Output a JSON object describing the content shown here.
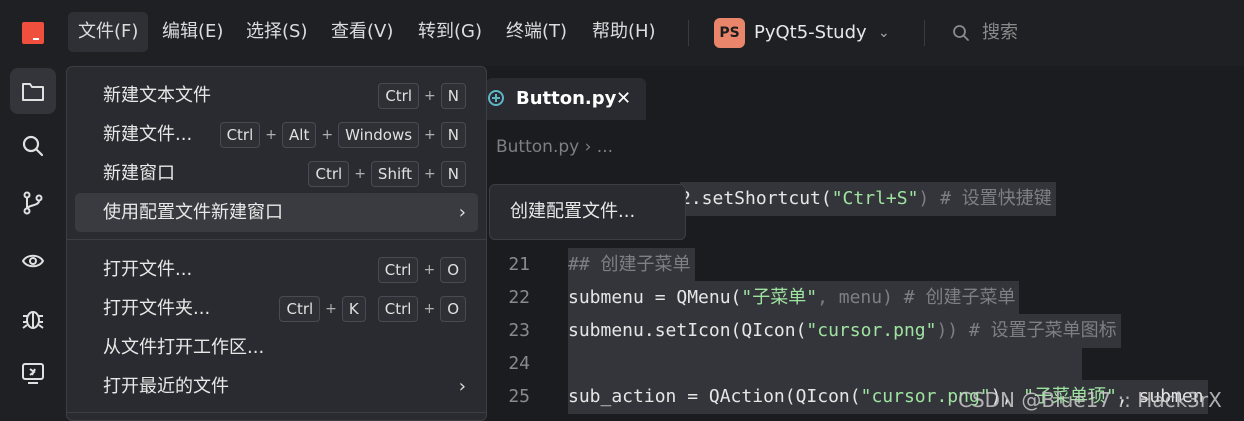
{
  "menubar": {
    "items": [
      "文件(F)",
      "编辑(E)",
      "选择(S)",
      "查看(V)",
      "转到(G)",
      "终端(T)",
      "帮助(H)"
    ],
    "project_badge": "PS",
    "project_name": "PyQt5-Study",
    "search_label": "搜索"
  },
  "activity_icons": [
    "explorer-icon",
    "search-icon",
    "source-control-icon",
    "run-icon",
    "debug-icon",
    "remote-icon"
  ],
  "file_menu": {
    "items": [
      {
        "label": "新建文本文件",
        "keys": [
          "Ctrl",
          "N"
        ]
      },
      {
        "label": "新建文件...",
        "keys": [
          "Ctrl",
          "Alt",
          "Windows",
          "N"
        ]
      },
      {
        "label": "新建窗口",
        "keys": [
          "Ctrl",
          "Shift",
          "N"
        ]
      },
      {
        "label": "使用配置文件新建窗口",
        "arrow": "›"
      },
      {
        "label": "打开文件...",
        "keys": [
          "Ctrl",
          "O"
        ]
      },
      {
        "label": "打开文件夹...",
        "keys": [
          "Ctrl",
          "K"
        ],
        "keys2": [
          "Ctrl",
          "O"
        ]
      },
      {
        "label": "从文件打开工作区..."
      },
      {
        "label": "打开最近的文件",
        "arrow": "›"
      }
    ]
  },
  "submenu": {
    "label": "创建配置文件..."
  },
  "editor": {
    "tab_label": "Button.py",
    "tab_close": "✕",
    "breadcrumb": "Button.py › ...",
    "lines": [
      {
        "num": "",
        "segments": [
          {
            "t": "2.setShortcut(",
            "c": "c-fn"
          },
          {
            "t": "\"Ctrl+S\"",
            "c": "c-str"
          },
          {
            "t": ") # 设置快捷键",
            "c": "c-com"
          }
        ]
      },
      {
        "num": "21",
        "segments": [
          {
            "t": "## 创建子菜单",
            "c": "c-com"
          }
        ]
      },
      {
        "num": "22",
        "segments": [
          {
            "t": "submenu = QMenu(",
            "c": "c-fn"
          },
          {
            "t": "\"子菜单\"",
            "c": "c-str"
          },
          {
            "t": ", menu) # 创建子菜单",
            "c": "c-com"
          }
        ]
      },
      {
        "num": "23",
        "segments": [
          {
            "t": "submenu.setIcon(QIcon(",
            "c": "c-fn"
          },
          {
            "t": "\"cursor.png\"",
            "c": "c-str"
          },
          {
            "t": ")) # 设置子菜单图标",
            "c": "c-com"
          }
        ]
      },
      {
        "num": "24",
        "segments": []
      },
      {
        "num": "25",
        "segments": [
          {
            "t": "sub_action = QAction(QIcon(",
            "c": "c-fn"
          },
          {
            "t": "\"cursor.png\"",
            "c": "c-str"
          },
          {
            "t": "), ",
            "c": "c-fn"
          },
          {
            "t": "\"子菜单项\"",
            "c": "c-str"
          },
          {
            "t": ", submen",
            "c": "c-fn"
          }
        ]
      }
    ]
  },
  "watermark": "CSDN @Blue17 :: Hack3rX"
}
